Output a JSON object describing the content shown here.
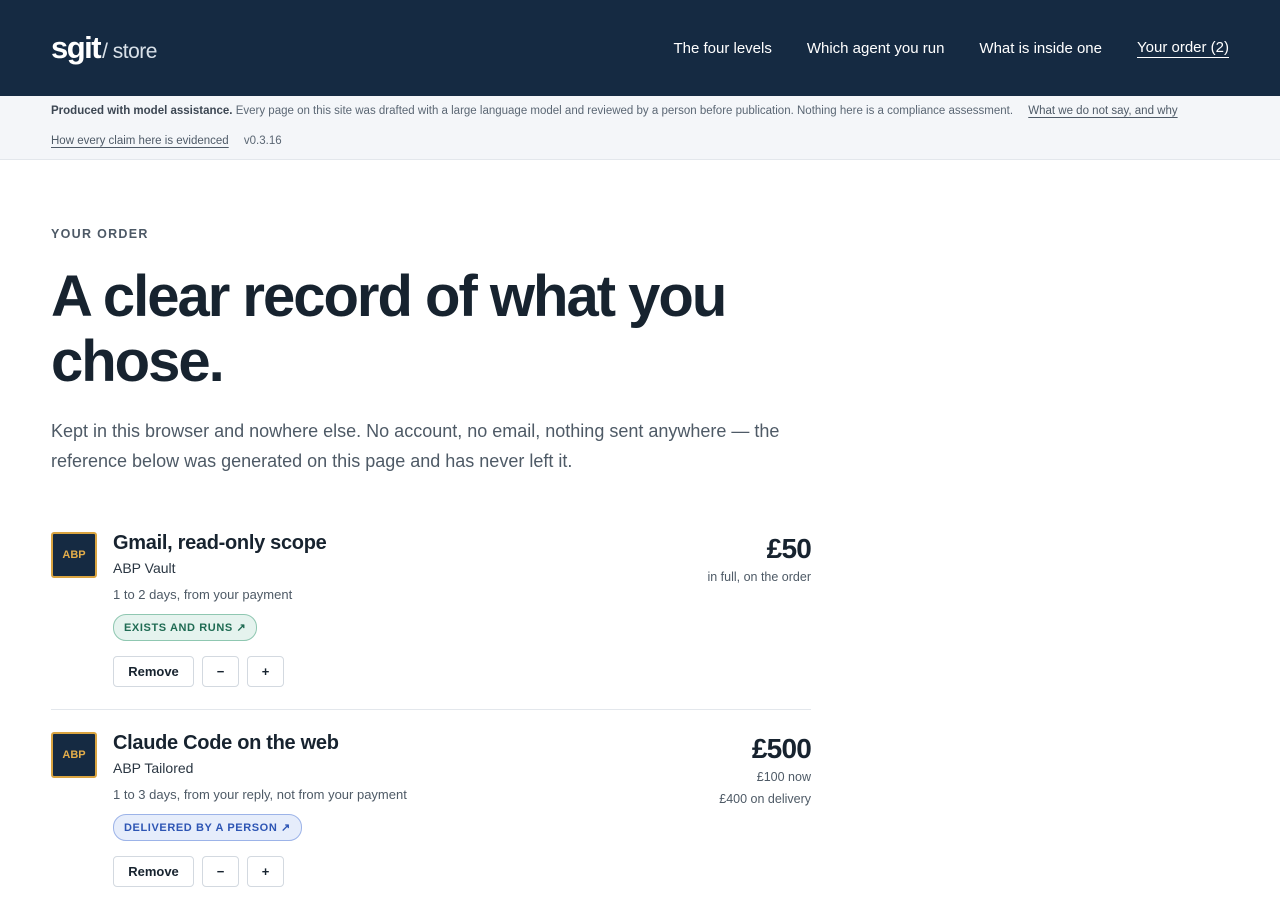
{
  "brand": {
    "name": "sgit",
    "sub": "/ store"
  },
  "nav": [
    {
      "label": "The four levels"
    },
    {
      "label": "Which agent you run"
    },
    {
      "label": "What is inside one"
    },
    {
      "label": "Your order (2)"
    }
  ],
  "notice": {
    "lead": "Produced with model assistance.",
    "text": "Every page on this site was drafted with a large language model and reviewed by a person before publication. Nothing here is a compliance assessment.",
    "link_disclaimers": "What we do not say, and why",
    "link_evidence": "How every claim here is evidenced",
    "version": "v0.3.16"
  },
  "page": {
    "eyebrow": "YOUR ORDER",
    "headline": "A clear record of what you chose.",
    "lede": "Kept in this browser and nowhere else. No account, no email, nothing sent anywhere — the reference below was generated on this page and has never left it."
  },
  "order": {
    "items": [
      {
        "badge": "ABP",
        "title": "Gmail, read-only scope",
        "product": "ABP Vault",
        "eta": "1 to 2 days, from your payment",
        "pill": "EXISTS AND RUNS ↗",
        "price": "£50",
        "price_notes": [
          "in full, on the order"
        ],
        "remove_label": "Remove",
        "minus_label": "−",
        "plus_label": "+"
      },
      {
        "badge": "ABP",
        "title": "Claude Code on the web",
        "product": "ABP Tailored",
        "eta": "1 to 3 days, from your reply, not from your payment",
        "pill": "DELIVERED BY A PERSON ↗",
        "price": "£500",
        "price_notes": [
          "£100 now",
          "£400 on delivery"
        ],
        "remove_label": "Remove",
        "minus_label": "−",
        "plus_label": "+"
      }
    ]
  },
  "colors": {
    "header_bg": "#152a42",
    "badge_border": "#d9a441",
    "pill_green": "#1f6b53",
    "pill_blue": "#2d55b4"
  }
}
